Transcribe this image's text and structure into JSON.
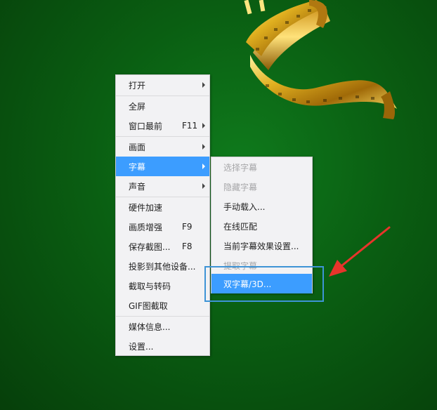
{
  "colors": {
    "background": "#0a5e12",
    "menu_background": "#f2f2f4",
    "active_item": "#3c9dff",
    "highlight_box": "#3e94d6",
    "annotation_arrow": "#e8342b"
  },
  "main_menu": {
    "items": [
      {
        "label": "打开",
        "submenu": true
      },
      {
        "label": "全屏"
      },
      {
        "label": "窗口最前",
        "shortcut": "F11",
        "submenu": true
      },
      {
        "label": "画面",
        "submenu": true
      },
      {
        "label": "字幕",
        "submenu": true,
        "active": true
      },
      {
        "label": "声音",
        "submenu": true
      },
      {
        "label": "硬件加速"
      },
      {
        "label": "画质增强",
        "shortcut": "F9"
      },
      {
        "label": "保存截图...",
        "shortcut": "F8"
      },
      {
        "label": "投影到其他设备..."
      },
      {
        "label": "截取与转码"
      },
      {
        "label": "GIF图截取"
      },
      {
        "label": "媒体信息..."
      },
      {
        "label": "设置..."
      }
    ]
  },
  "subtitle_submenu": {
    "items": [
      {
        "label": "选择字幕",
        "disabled": true
      },
      {
        "label": "隐藏字幕",
        "disabled": true
      },
      {
        "label": "手动载入..."
      },
      {
        "label": "在线匹配"
      },
      {
        "label": "当前字幕效果设置..."
      },
      {
        "label": "提取字幕",
        "disabled": true
      },
      {
        "label": "双字幕/3D...",
        "active": true
      }
    ]
  }
}
